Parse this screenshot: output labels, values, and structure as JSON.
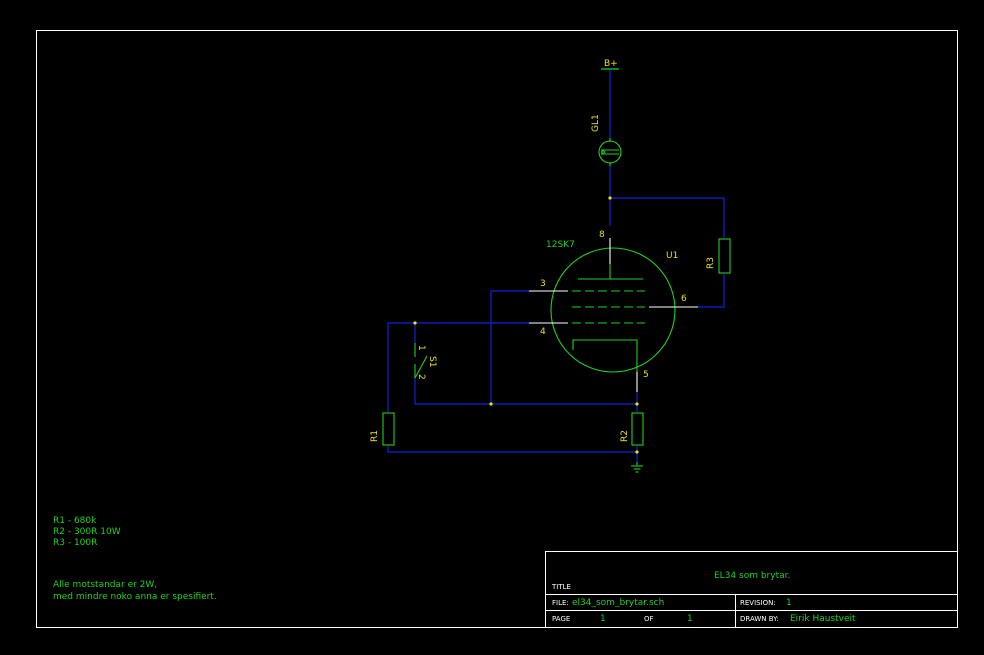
{
  "colors": {
    "background": "#000000",
    "border": "#ffffff",
    "wire": "#0a26d8",
    "component": "#20d020",
    "label": "#e8e020",
    "text": "#20d020",
    "title_text": "#ffffff"
  },
  "components": {
    "bplus": {
      "label": "B+"
    },
    "gl1": {
      "ref": "GL1"
    },
    "u1": {
      "ref": "U1",
      "value": "12SK7",
      "pins": {
        "p8": "8",
        "p3": "3",
        "p4": "4",
        "p6": "6",
        "p5": "5"
      }
    },
    "r1": {
      "ref": "R1"
    },
    "r2": {
      "ref": "R2"
    },
    "r3": {
      "ref": "R3"
    },
    "s1": {
      "ref": "S1",
      "pin1": "1",
      "pin2": "2"
    }
  },
  "notes": {
    "values": [
      "R1 - 680k",
      "R2 - 300R 10W",
      "R3 - 100R"
    ],
    "tolerance": [
      "Alle motstandar er 2W,",
      "med mindre noko anna er spesifiert."
    ]
  },
  "title_block": {
    "title": "EL34 som brytar.",
    "title_label": "TITLE",
    "file_label": "FILE:",
    "file": "el34_som_brytar.sch",
    "revision_label": "REVISION:",
    "revision": "1",
    "page_label": "PAGE",
    "page": "1",
    "of_label": "OF",
    "of": "1",
    "drawn_by_label": "DRAWN BY:",
    "drawn_by": "Eirik Haustveit"
  }
}
